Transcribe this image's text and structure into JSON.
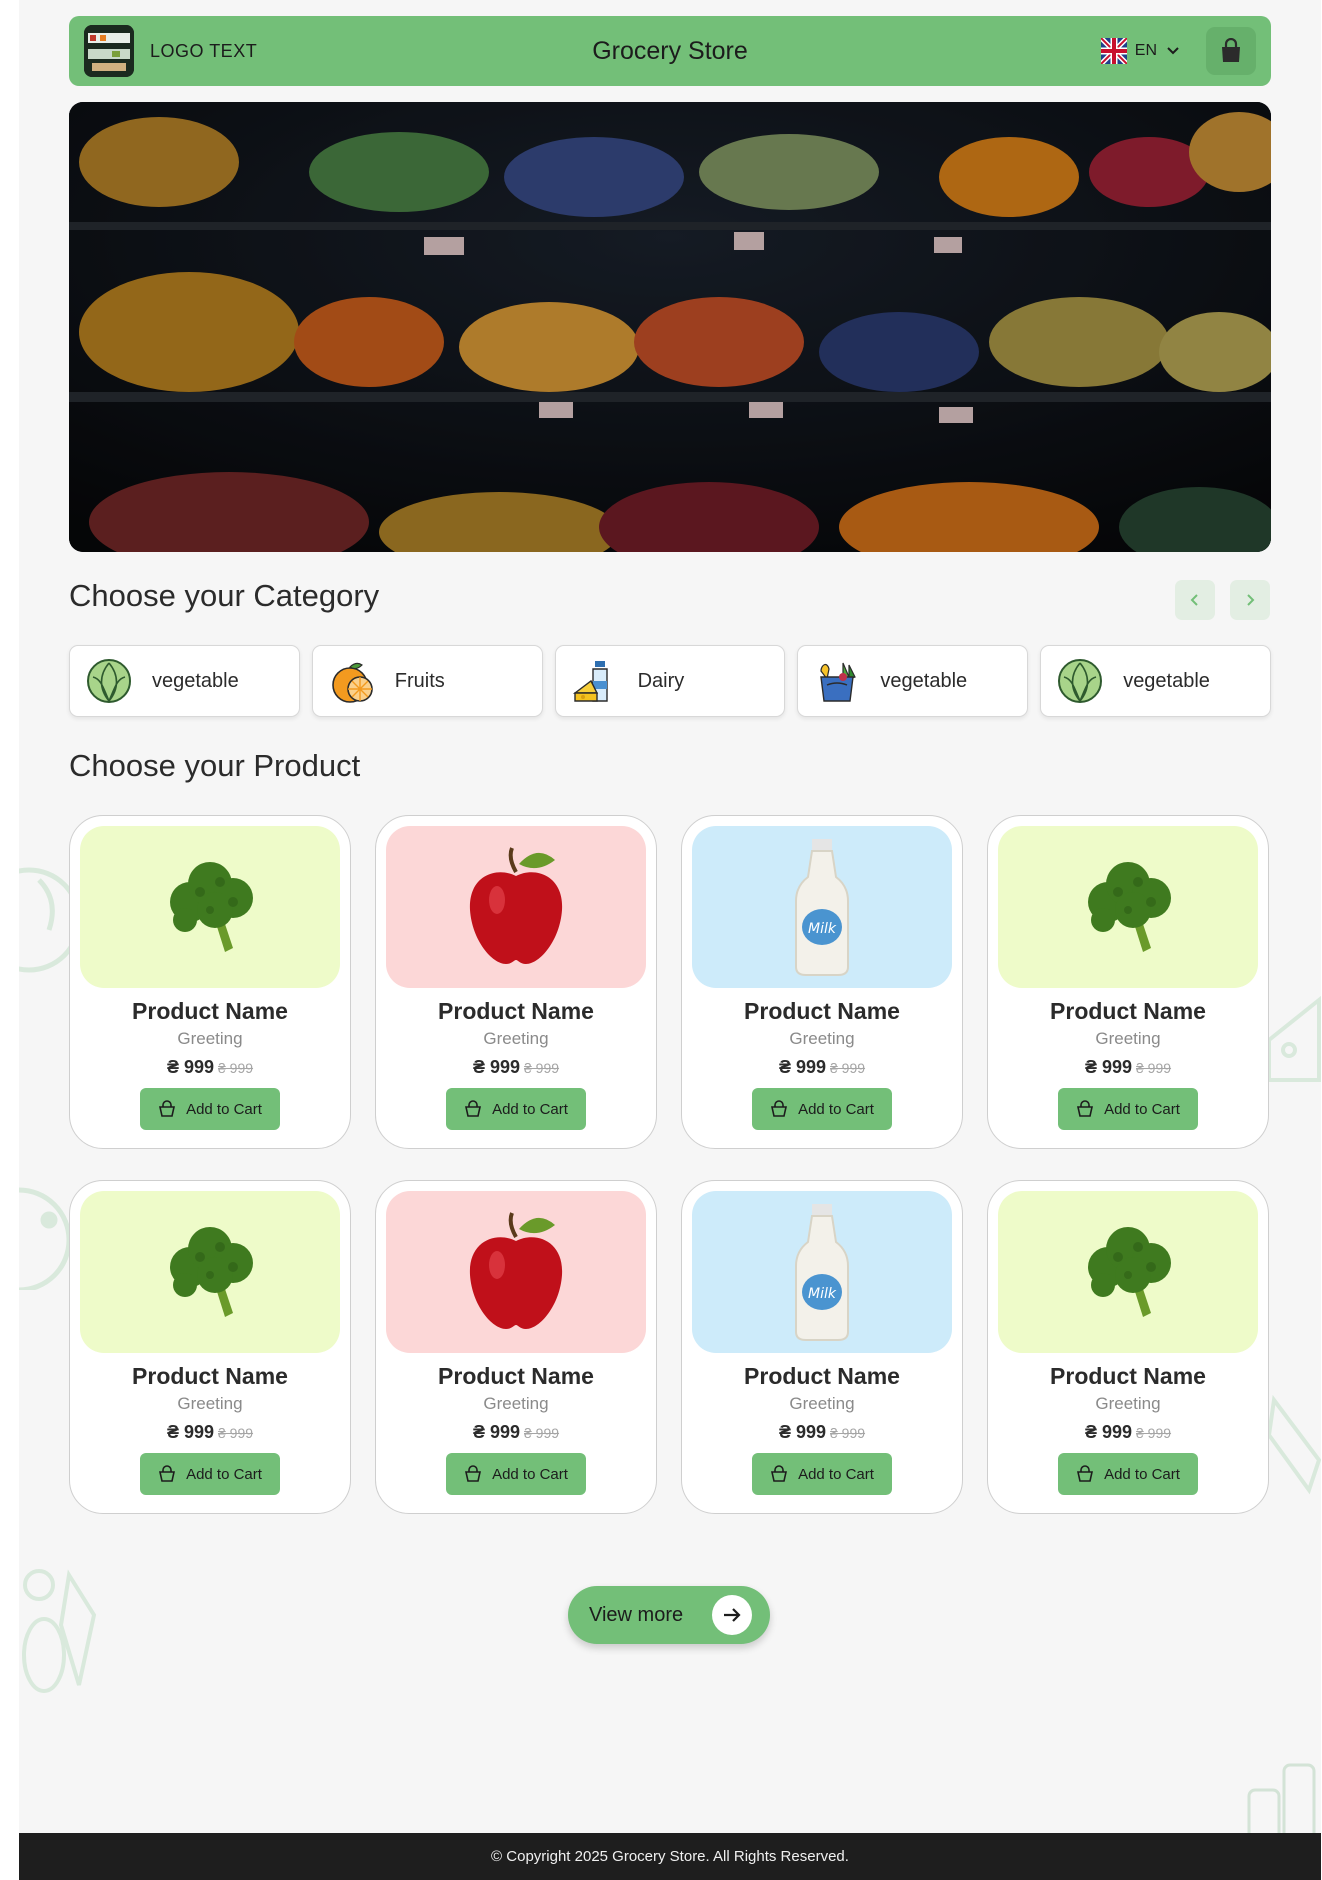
{
  "header": {
    "logo_text": "LOGO TEXT",
    "title": "Grocery Store",
    "language": "EN",
    "icons": {
      "logo": "logo-image",
      "flag": "uk-flag-icon",
      "dropdown": "chevron-down-icon",
      "cart": "shopping-bag-icon"
    }
  },
  "hero": {
    "image": "grocery-shelves-photo"
  },
  "categories": {
    "title": "Choose your Category",
    "items": [
      {
        "label": "vegetable",
        "icon": "cabbage-icon"
      },
      {
        "label": "Fruits",
        "icon": "orange-icon"
      },
      {
        "label": "Dairy",
        "icon": "milk-cheese-icon"
      },
      {
        "label": "vegetable",
        "icon": "grocery-bag-icon"
      },
      {
        "label": "vegetable",
        "icon": "cabbage-icon"
      }
    ]
  },
  "products": {
    "title": "Choose your Product",
    "items": [
      {
        "name": "Product Name",
        "subtitle": "Greeting",
        "price": "₴ 999",
        "old_price": "₴ 999",
        "button": "Add to Cart",
        "image": "broccoli",
        "bg": "#eefbc9"
      },
      {
        "name": "Product Name",
        "subtitle": "Greeting",
        "price": "₴ 999",
        "old_price": "₴ 999",
        "button": "Add to Cart",
        "image": "apple",
        "bg": "#fcd7d7"
      },
      {
        "name": "Product Name",
        "subtitle": "Greeting",
        "price": "₴ 999",
        "old_price": "₴ 999",
        "button": "Add to Cart",
        "image": "milk-bottle",
        "bg": "#cdebfa"
      },
      {
        "name": "Product Name",
        "subtitle": "Greeting",
        "price": "₴ 999",
        "old_price": "₴ 999",
        "button": "Add to Cart",
        "image": "broccoli",
        "bg": "#eefbc9"
      },
      {
        "name": "Product Name",
        "subtitle": "Greeting",
        "price": "₴ 999",
        "old_price": "₴ 999",
        "button": "Add to Cart",
        "image": "broccoli",
        "bg": "#eefbc9"
      },
      {
        "name": "Product Name",
        "subtitle": "Greeting",
        "price": "₴ 999",
        "old_price": "₴ 999",
        "button": "Add to Cart",
        "image": "apple",
        "bg": "#fcd7d7"
      },
      {
        "name": "Product Name",
        "subtitle": "Greeting",
        "price": "₴ 999",
        "old_price": "₴ 999",
        "button": "Add to Cart",
        "image": "milk-bottle",
        "bg": "#cdebfa"
      },
      {
        "name": "Product Name",
        "subtitle": "Greeting",
        "price": "₴ 999",
        "old_price": "₴ 999",
        "button": "Add to Cart",
        "image": "broccoli",
        "bg": "#eefbc9"
      }
    ]
  },
  "view_more": {
    "label": "View more",
    "icon": "arrow-right-icon"
  },
  "footer": {
    "copyright": "© Copyright 2025 Grocery Store. All Rights Reserved."
  },
  "colors": {
    "accent": "#73bf78",
    "page_bg": "#f6f6f6",
    "footer_bg": "#1e1e1e"
  }
}
